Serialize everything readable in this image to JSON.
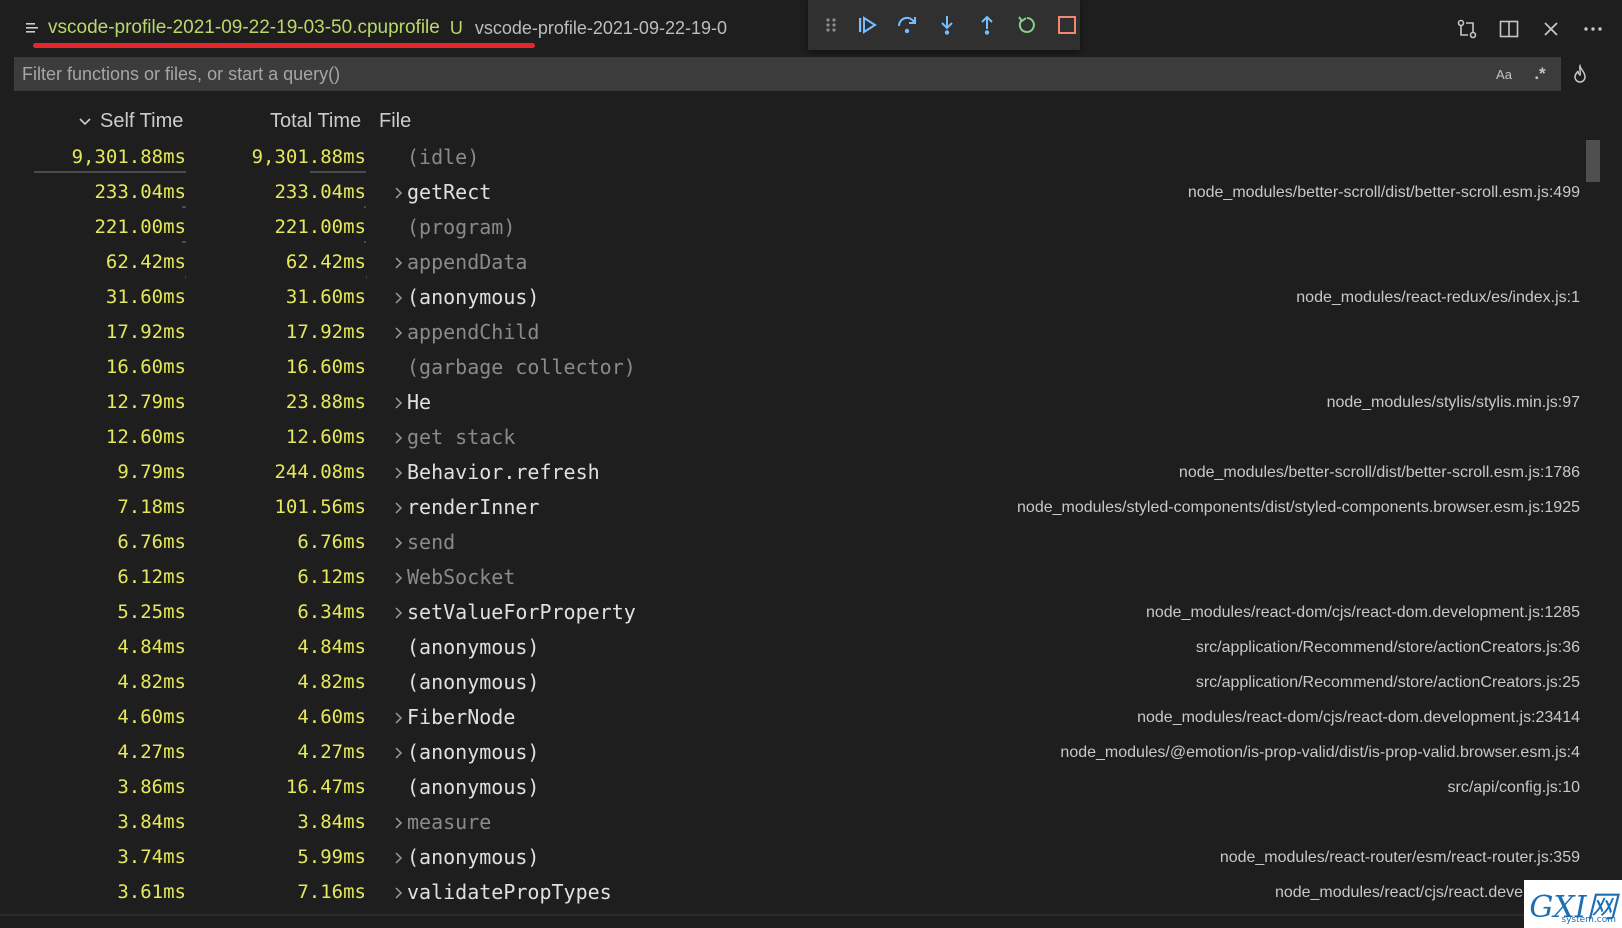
{
  "tab": {
    "title": "vscode-profile-2021-09-22-19-03-50.cpuprofile",
    "badge": "U",
    "description": "vscode-profile-2021-09-22-19-0"
  },
  "debug_toolbar": {
    "icons": [
      "gripper-icon",
      "continue-icon",
      "step-over-icon",
      "step-into-icon",
      "step-out-icon",
      "restart-icon",
      "stop-icon"
    ]
  },
  "editor_actions": {
    "icons": [
      "compare-changes-icon",
      "split-editor-icon",
      "close-icon",
      "more-actions-icon"
    ]
  },
  "filter": {
    "placeholder": "Filter functions or files, or start a query()",
    "case_label": "Aa",
    "regex_label": ".*"
  },
  "columns": {
    "self": "Self Time",
    "total": "Total Time",
    "file": "File"
  },
  "colors": {
    "tab_title": "#b9d76a",
    "time_values": "#e5e85a",
    "underline_annotation": "#e5262a"
  },
  "rows": [
    {
      "self": "9,301.88ms",
      "total": "9,301.88ms",
      "name": "(idle)",
      "file": "",
      "expandable": false,
      "dim": true,
      "self_fraction": 1.0,
      "total_fraction": 0.37
    },
    {
      "self": "233.04ms",
      "total": "233.04ms",
      "name": "getRect",
      "file": "node_modules/better-scroll/dist/better-scroll.esm.js:499",
      "expandable": true,
      "dim": false,
      "self_fraction": 0.025,
      "total_fraction": 0.01
    },
    {
      "self": "221.00ms",
      "total": "221.00ms",
      "name": "(program)",
      "file": "",
      "expandable": false,
      "dim": true,
      "self_fraction": 0.024,
      "total_fraction": 0.01
    },
    {
      "self": "62.42ms",
      "total": "62.42ms",
      "name": "appendData",
      "file": "",
      "expandable": true,
      "dim": true,
      "self_fraction": 0.007,
      "total_fraction": 0.003
    },
    {
      "self": "31.60ms",
      "total": "31.60ms",
      "name": "(anonymous)",
      "file": "node_modules/react-redux/es/index.js:1",
      "expandable": true,
      "dim": false,
      "self_fraction": 0,
      "total_fraction": 0
    },
    {
      "self": "17.92ms",
      "total": "17.92ms",
      "name": "appendChild",
      "file": "",
      "expandable": true,
      "dim": true,
      "self_fraction": 0,
      "total_fraction": 0
    },
    {
      "self": "16.60ms",
      "total": "16.60ms",
      "name": "(garbage collector)",
      "file": "",
      "expandable": false,
      "dim": true,
      "self_fraction": 0,
      "total_fraction": 0
    },
    {
      "self": "12.79ms",
      "total": "23.88ms",
      "name": "He",
      "file": "node_modules/stylis/stylis.min.js:97",
      "expandable": true,
      "dim": false,
      "self_fraction": 0,
      "total_fraction": 0
    },
    {
      "self": "12.60ms",
      "total": "12.60ms",
      "name": "get stack",
      "file": "",
      "expandable": true,
      "dim": true,
      "self_fraction": 0,
      "total_fraction": 0
    },
    {
      "self": "9.79ms",
      "total": "244.08ms",
      "name": "Behavior.refresh",
      "file": "node_modules/better-scroll/dist/better-scroll.esm.js:1786",
      "expandable": true,
      "dim": false,
      "self_fraction": 0,
      "total_fraction": 0
    },
    {
      "self": "7.18ms",
      "total": "101.56ms",
      "name": "renderInner",
      "file": "node_modules/styled-components/dist/styled-components.browser.esm.js:1925",
      "expandable": true,
      "dim": false,
      "self_fraction": 0,
      "total_fraction": 0
    },
    {
      "self": "6.76ms",
      "total": "6.76ms",
      "name": "send",
      "file": "",
      "expandable": true,
      "dim": true,
      "self_fraction": 0,
      "total_fraction": 0
    },
    {
      "self": "6.12ms",
      "total": "6.12ms",
      "name": "WebSocket",
      "file": "",
      "expandable": true,
      "dim": true,
      "self_fraction": 0,
      "total_fraction": 0
    },
    {
      "self": "5.25ms",
      "total": "6.34ms",
      "name": "setValueForProperty",
      "file": "node_modules/react-dom/cjs/react-dom.development.js:1285",
      "expandable": true,
      "dim": false,
      "self_fraction": 0,
      "total_fraction": 0
    },
    {
      "self": "4.84ms",
      "total": "4.84ms",
      "name": "(anonymous)",
      "file": "src/application/Recommend/store/actionCreators.js:36",
      "expandable": false,
      "dim": false,
      "self_fraction": 0,
      "total_fraction": 0
    },
    {
      "self": "4.82ms",
      "total": "4.82ms",
      "name": "(anonymous)",
      "file": "src/application/Recommend/store/actionCreators.js:25",
      "expandable": false,
      "dim": false,
      "self_fraction": 0,
      "total_fraction": 0
    },
    {
      "self": "4.60ms",
      "total": "4.60ms",
      "name": "FiberNode",
      "file": "node_modules/react-dom/cjs/react-dom.development.js:23414",
      "expandable": true,
      "dim": false,
      "self_fraction": 0,
      "total_fraction": 0
    },
    {
      "self": "4.27ms",
      "total": "4.27ms",
      "name": "(anonymous)",
      "file": "node_modules/@emotion/is-prop-valid/dist/is-prop-valid.browser.esm.js:4",
      "expandable": true,
      "dim": false,
      "self_fraction": 0,
      "total_fraction": 0
    },
    {
      "self": "3.86ms",
      "total": "16.47ms",
      "name": "(anonymous)",
      "file": "src/api/config.js:10",
      "expandable": false,
      "dim": false,
      "self_fraction": 0,
      "total_fraction": 0
    },
    {
      "self": "3.84ms",
      "total": "3.84ms",
      "name": "measure",
      "file": "",
      "expandable": true,
      "dim": true,
      "self_fraction": 0,
      "total_fraction": 0
    },
    {
      "self": "3.74ms",
      "total": "5.99ms",
      "name": "(anonymous)",
      "file": "node_modules/react-router/esm/react-router.js:359",
      "expandable": true,
      "dim": false,
      "self_fraction": 0,
      "total_fraction": 0
    },
    {
      "self": "3.61ms",
      "total": "7.16ms",
      "name": "validatePropTypes",
      "file": "node_modules/react/cjs/react.development",
      "expandable": true,
      "dim": false,
      "self_fraction": 0,
      "total_fraction": 0
    }
  ],
  "watermark": {
    "text": "GXI网",
    "subtext": "system.com"
  }
}
